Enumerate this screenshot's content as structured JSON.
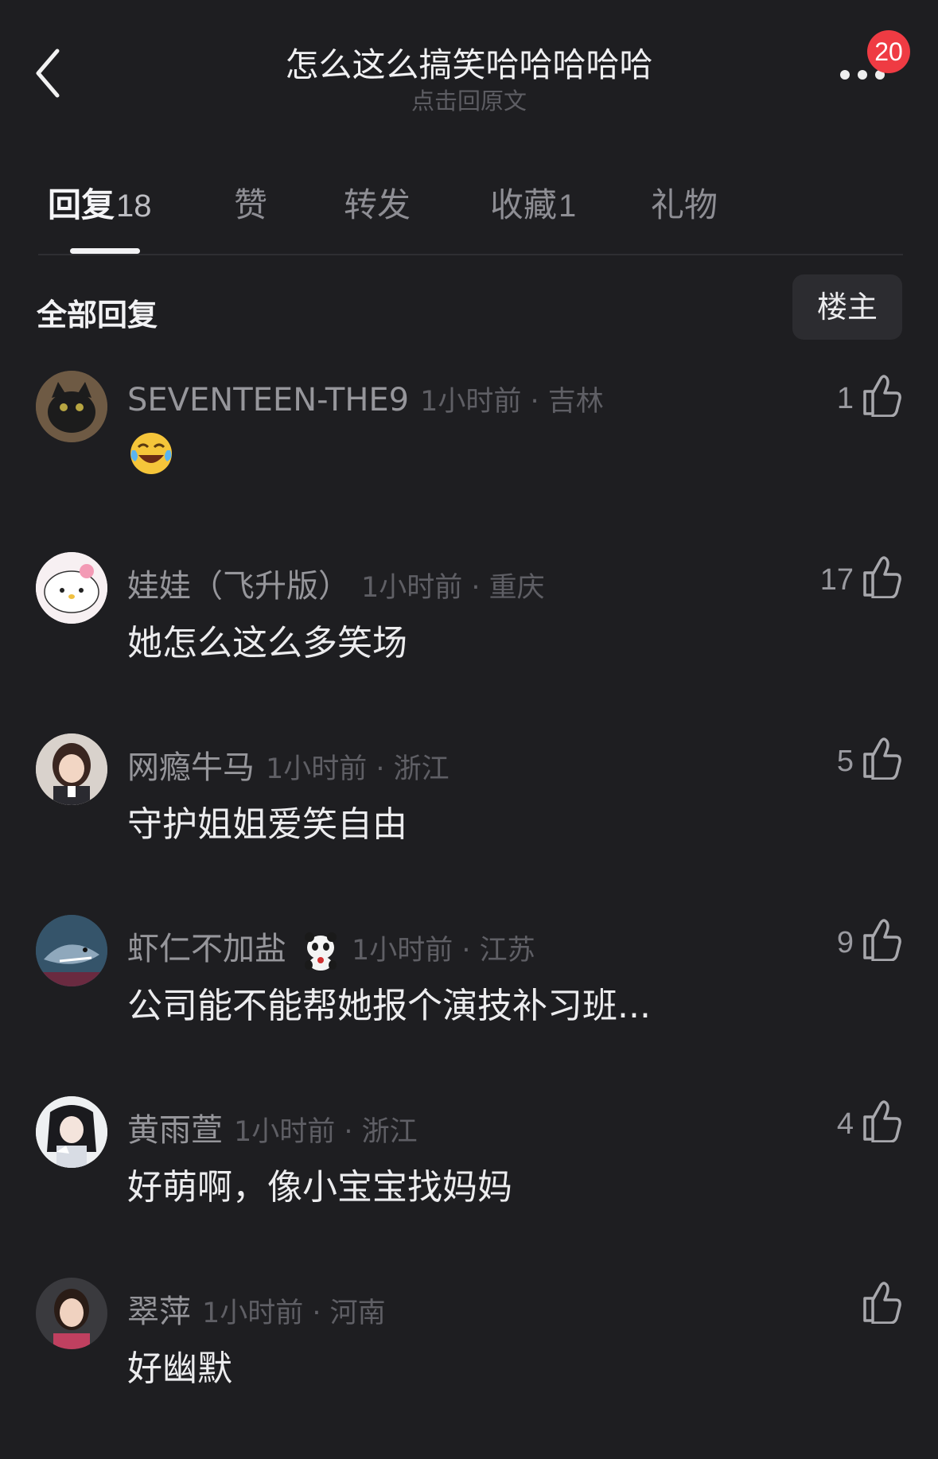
{
  "header": {
    "title": "怎么这么搞笑哈哈哈哈哈",
    "subtitle": "点击回原文",
    "badge": "20",
    "back_icon": "chevron-left-icon",
    "more_icon": "more-dots-icon"
  },
  "tabs": [
    {
      "label": "回复",
      "count": "18",
      "active": true
    },
    {
      "label": "赞",
      "count": "",
      "active": false
    },
    {
      "label": "转发",
      "count": "",
      "active": false
    },
    {
      "label": "收藏",
      "count": "1",
      "active": false
    },
    {
      "label": "礼物",
      "count": "",
      "active": false
    }
  ],
  "section": {
    "title": "全部回复",
    "owner_button": "楼主"
  },
  "comments": [
    {
      "user": "SEVENTEEN-THE9",
      "meta": "1小时前 · 吉林",
      "text": "",
      "emoji": "laughing-tears-emoji",
      "likes": "1"
    },
    {
      "user": "娃娃（飞升版）",
      "meta": "1小时前 · 重庆",
      "text": "她怎么这么多笑场",
      "likes": "17"
    },
    {
      "user": "网瘾牛马",
      "meta": "1小时前 · 浙江",
      "text": "守护姐姐爱笑自由",
      "likes": "5"
    },
    {
      "user": "虾仁不加盐",
      "meta": "1小时前 · 江苏",
      "text": "公司能不能帮她报个演技补习班...",
      "likes": "9",
      "sticker": "panda-icon"
    },
    {
      "user": "黄雨萱",
      "meta": "1小时前 · 浙江",
      "text": "好萌啊，像小宝宝找妈妈",
      "likes": "4"
    },
    {
      "user": "翠萍",
      "meta": "1小时前 · 河南",
      "text": "好幽默",
      "likes": ""
    }
  ],
  "colors": {
    "background": "#1e1e21",
    "badge": "#ef3b43",
    "muted": "#96969b"
  }
}
